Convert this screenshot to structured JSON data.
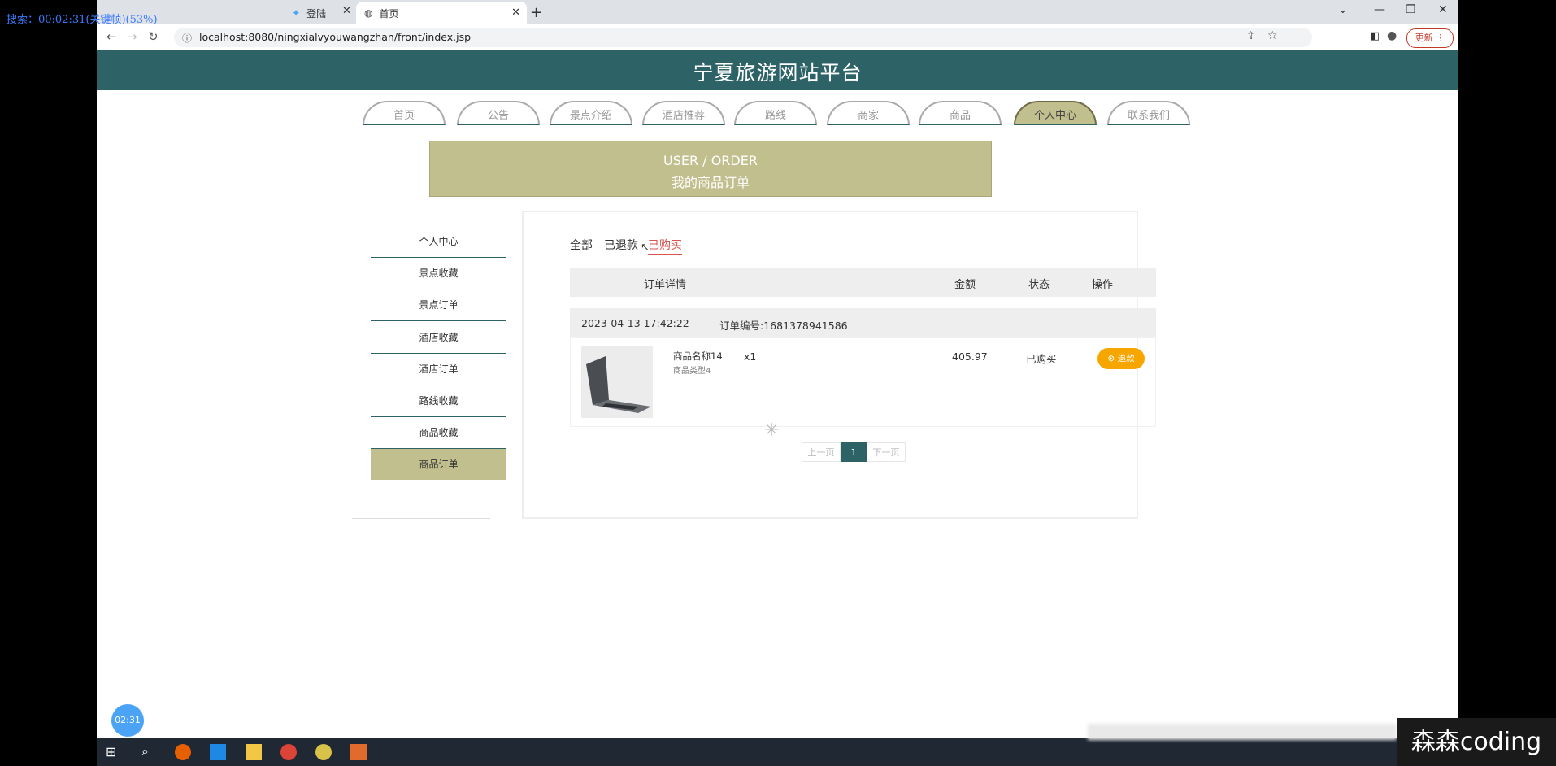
{
  "overlay": {
    "timer_text": "搜索：00:02:31(关键帧)(53%)",
    "bubble_time": "02:31",
    "watermark": "森森coding"
  },
  "browser": {
    "tabs": [
      {
        "label": "登陆"
      },
      {
        "label": "首页"
      }
    ],
    "url": "localhost:8080/ningxialvyouwangzhan/front/index.jsp",
    "update_label": "更新"
  },
  "site": {
    "title": "宁夏旅游网站平台",
    "nav": [
      "首页",
      "公告",
      "景点介绍",
      "酒店推荐",
      "路线",
      "商家",
      "商品",
      "个人中心",
      "联系我们"
    ],
    "nav_active": "个人中心"
  },
  "banner": {
    "en": "USER / ORDER",
    "cn": "我的商品订单"
  },
  "sidebar": {
    "items": [
      "个人中心",
      "景点收藏",
      "景点订单",
      "酒店收藏",
      "酒店订单",
      "路线收藏",
      "商品收藏",
      "商品订单"
    ],
    "active": "商品订单"
  },
  "orders": {
    "filters": [
      "全部",
      "已退款",
      "已购买"
    ],
    "filter_active": "已购买",
    "columns": {
      "detail": "订单详情",
      "amount": "金额",
      "status": "状态",
      "action": "操作"
    },
    "order": {
      "time": "2023-04-13 17:42:22",
      "number": "订单编号:1681378941586",
      "product_name": "商品名称14",
      "product_type": "商品类型4",
      "quantity": "x1",
      "amount": "405.97",
      "status": "已购买",
      "refund_label": "退款"
    },
    "pagination": {
      "prev": "上一页",
      "current": "1",
      "next": "下一页"
    }
  }
}
